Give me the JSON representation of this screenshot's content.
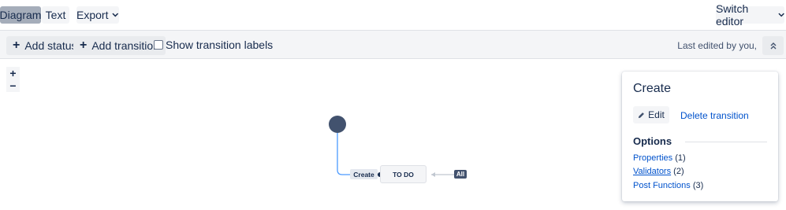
{
  "top_toolbar": {
    "view_tabs": [
      "Diagram",
      "Text"
    ],
    "export_label": "Export",
    "switch_editor_label": "Switch editor"
  },
  "editor_toolbar": {
    "add_status_label": "Add status",
    "add_transition_label": "Add transition",
    "show_labels_label": "Show transition labels",
    "show_labels_checked": false,
    "last_edited": "Last edited by you,"
  },
  "zoom": {
    "in": "+",
    "out": "−"
  },
  "diagram": {
    "transition_label": "Create",
    "status_label": "TO DO",
    "all_label": "All"
  },
  "panel": {
    "title": "Create",
    "edit_label": "Edit",
    "delete_label": "Delete transition",
    "options_heading": "Options",
    "options": [
      {
        "label": "Properties",
        "count": "(1)"
      },
      {
        "label": "Validators",
        "count": "(2)"
      },
      {
        "label": "Post Functions",
        "count": "(3)"
      }
    ]
  },
  "colors": {
    "accent": "#0052cc",
    "node": "#42526e",
    "connector": "#4c9aff"
  }
}
